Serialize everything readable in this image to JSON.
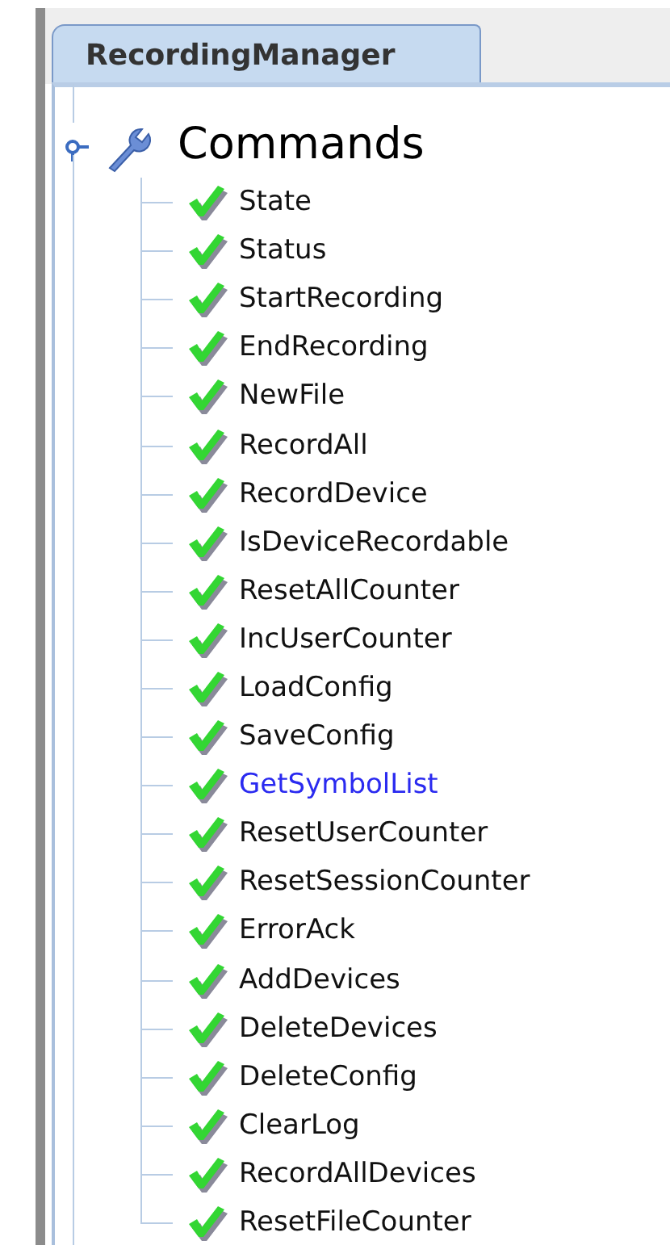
{
  "tab": {
    "label": "RecordingManager",
    "selected": true
  },
  "tree": {
    "label": "Commands",
    "expanded": true,
    "children": [
      {
        "label": "State",
        "checked": true,
        "selected": false
      },
      {
        "label": "Status",
        "checked": true,
        "selected": false
      },
      {
        "label": "StartRecording",
        "checked": true,
        "selected": false
      },
      {
        "label": "EndRecording",
        "checked": true,
        "selected": false
      },
      {
        "label": "NewFile",
        "checked": true,
        "selected": false
      },
      {
        "label": "RecordAll",
        "checked": true,
        "selected": false
      },
      {
        "label": "RecordDevice",
        "checked": true,
        "selected": false
      },
      {
        "label": "IsDeviceRecordable",
        "checked": true,
        "selected": false
      },
      {
        "label": "ResetAllCounter",
        "checked": true,
        "selected": false
      },
      {
        "label": "IncUserCounter",
        "checked": true,
        "selected": false
      },
      {
        "label": "LoadConfig",
        "checked": true,
        "selected": false
      },
      {
        "label": "SaveConfig",
        "checked": true,
        "selected": false
      },
      {
        "label": "GetSymbolList",
        "checked": true,
        "selected": true
      },
      {
        "label": "ResetUserCounter",
        "checked": true,
        "selected": false
      },
      {
        "label": "ResetSessionCounter",
        "checked": true,
        "selected": false
      },
      {
        "label": "ErrorAck",
        "checked": true,
        "selected": false
      },
      {
        "label": "AddDevices",
        "checked": true,
        "selected": false
      },
      {
        "label": "DeleteDevices",
        "checked": true,
        "selected": false
      },
      {
        "label": "DeleteConfig",
        "checked": true,
        "selected": false
      },
      {
        "label": "ClearLog",
        "checked": true,
        "selected": false
      },
      {
        "label": "RecordAllDevices",
        "checked": true,
        "selected": false
      },
      {
        "label": "ResetFileCounter",
        "checked": true,
        "selected": false
      }
    ]
  }
}
